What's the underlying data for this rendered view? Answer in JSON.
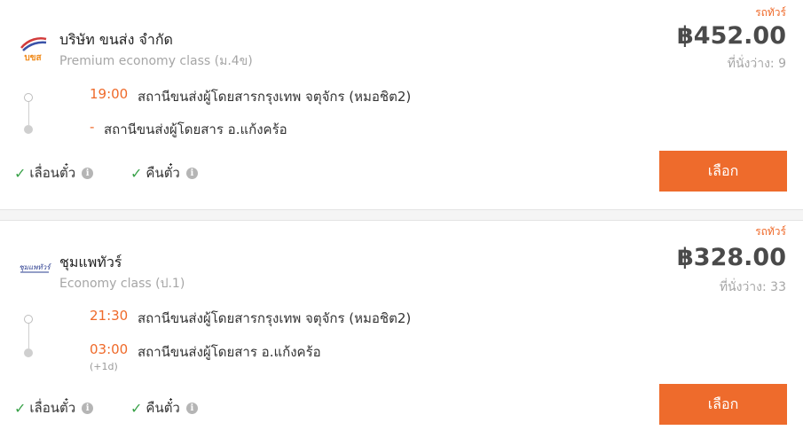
{
  "trips": [
    {
      "badge": "รถทัวร์",
      "operator": "บริษัท ขนส่ง จำกัด",
      "logo_text": "บขส",
      "class": "Premium economy class (ม.4ข)",
      "price": "฿452.00",
      "seats": "ที่นั่งว่าง: 9",
      "depart_time": "19:00",
      "depart_station": "สถานีขนส่งผู้โดยสารกรุงเทพ จตุจักร (หมอชิต2)",
      "arrive_time": "-",
      "arrive_station": "สถานีขนส่งผู้โดยสาร อ.แก้งคร้อ",
      "plus_day": "",
      "policy_1": "เลื่อนตั๋ว",
      "policy_2": "คืนตั๋ว",
      "select_label": "เลือก"
    },
    {
      "badge": "รถทัวร์",
      "operator": "ชุมแพทัวร์",
      "logo_text": "ชุมแพทัวร์",
      "class": "Economy class (ป.1)",
      "price": "฿328.00",
      "seats": "ที่นั่งว่าง: 33",
      "depart_time": "21:30",
      "depart_station": "สถานีขนส่งผู้โดยสารกรุงเทพ จตุจักร (หมอชิต2)",
      "arrive_time": "03:00",
      "arrive_station": "สถานีขนส่งผู้โดยสาร อ.แก้งคร้อ",
      "plus_day": "(+1d)",
      "policy_1": "เลื่อนตั๋ว",
      "policy_2": "คืนตั๋ว",
      "select_label": "เลือก"
    }
  ],
  "icons": {
    "check": "check-icon",
    "info": "info-icon"
  },
  "colors": {
    "accent": "#ee6b2c",
    "check": "#3aa24a",
    "muted": "#a6a6a6"
  }
}
